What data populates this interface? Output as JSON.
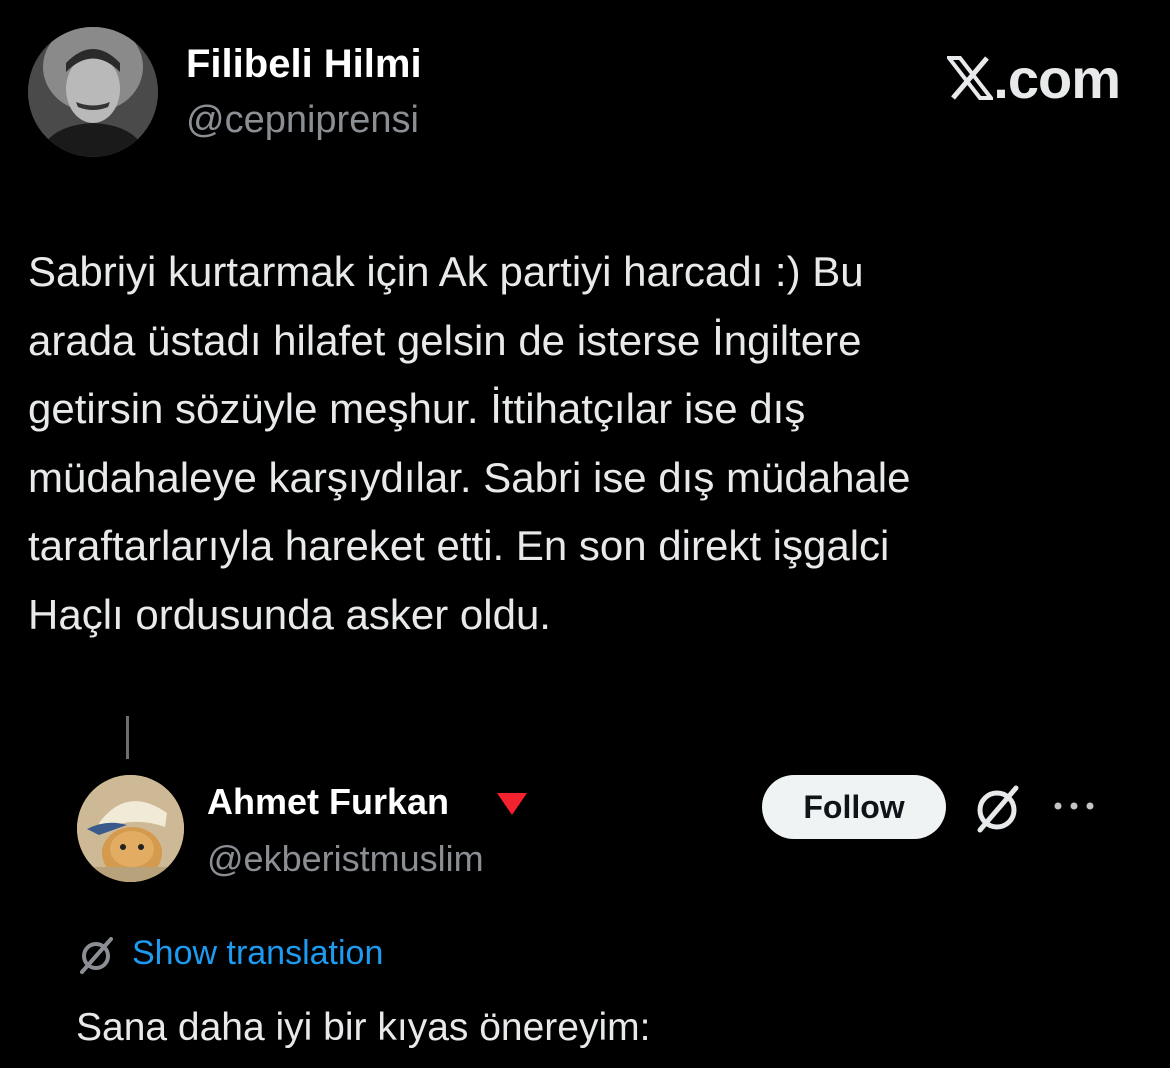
{
  "brand": {
    "label": ".com"
  },
  "main_tweet": {
    "author_name": "Filibeli Hilmi",
    "author_handle": "@cepniprensi",
    "text_lines": [
      "Sabriyi kurtarmak için Ak partiyi harcadı :) Bu",
      "arada üstadı hilafet gelsin de isterse İngiltere",
      "getirsin sözüyle meşhur. İttihatçılar ise dış",
      "müdahaleye karşıydılar. Sabri ise dış müdahale",
      "taraftarlarıyla hareket etti. En son direkt işgalci",
      "Haçlı ordusunda asker oldu."
    ]
  },
  "reply_tweet": {
    "author_name": "Ahmet Furkan",
    "author_handle": "@ekberistmuslim",
    "follow_label": "Follow",
    "translate_label": "Show translation",
    "text": "Sana daha iyi bir kıyas önereyim:"
  },
  "colors": {
    "background": "#000000",
    "text": "#e7e9ea",
    "secondary": "#8b8f94",
    "link": "#1d9bf0",
    "badge": "#f4212e"
  },
  "icons": [
    "x-logo-icon",
    "grok-icon",
    "more-options-icon",
    "translate-icon",
    "triangle-badge-icon"
  ]
}
